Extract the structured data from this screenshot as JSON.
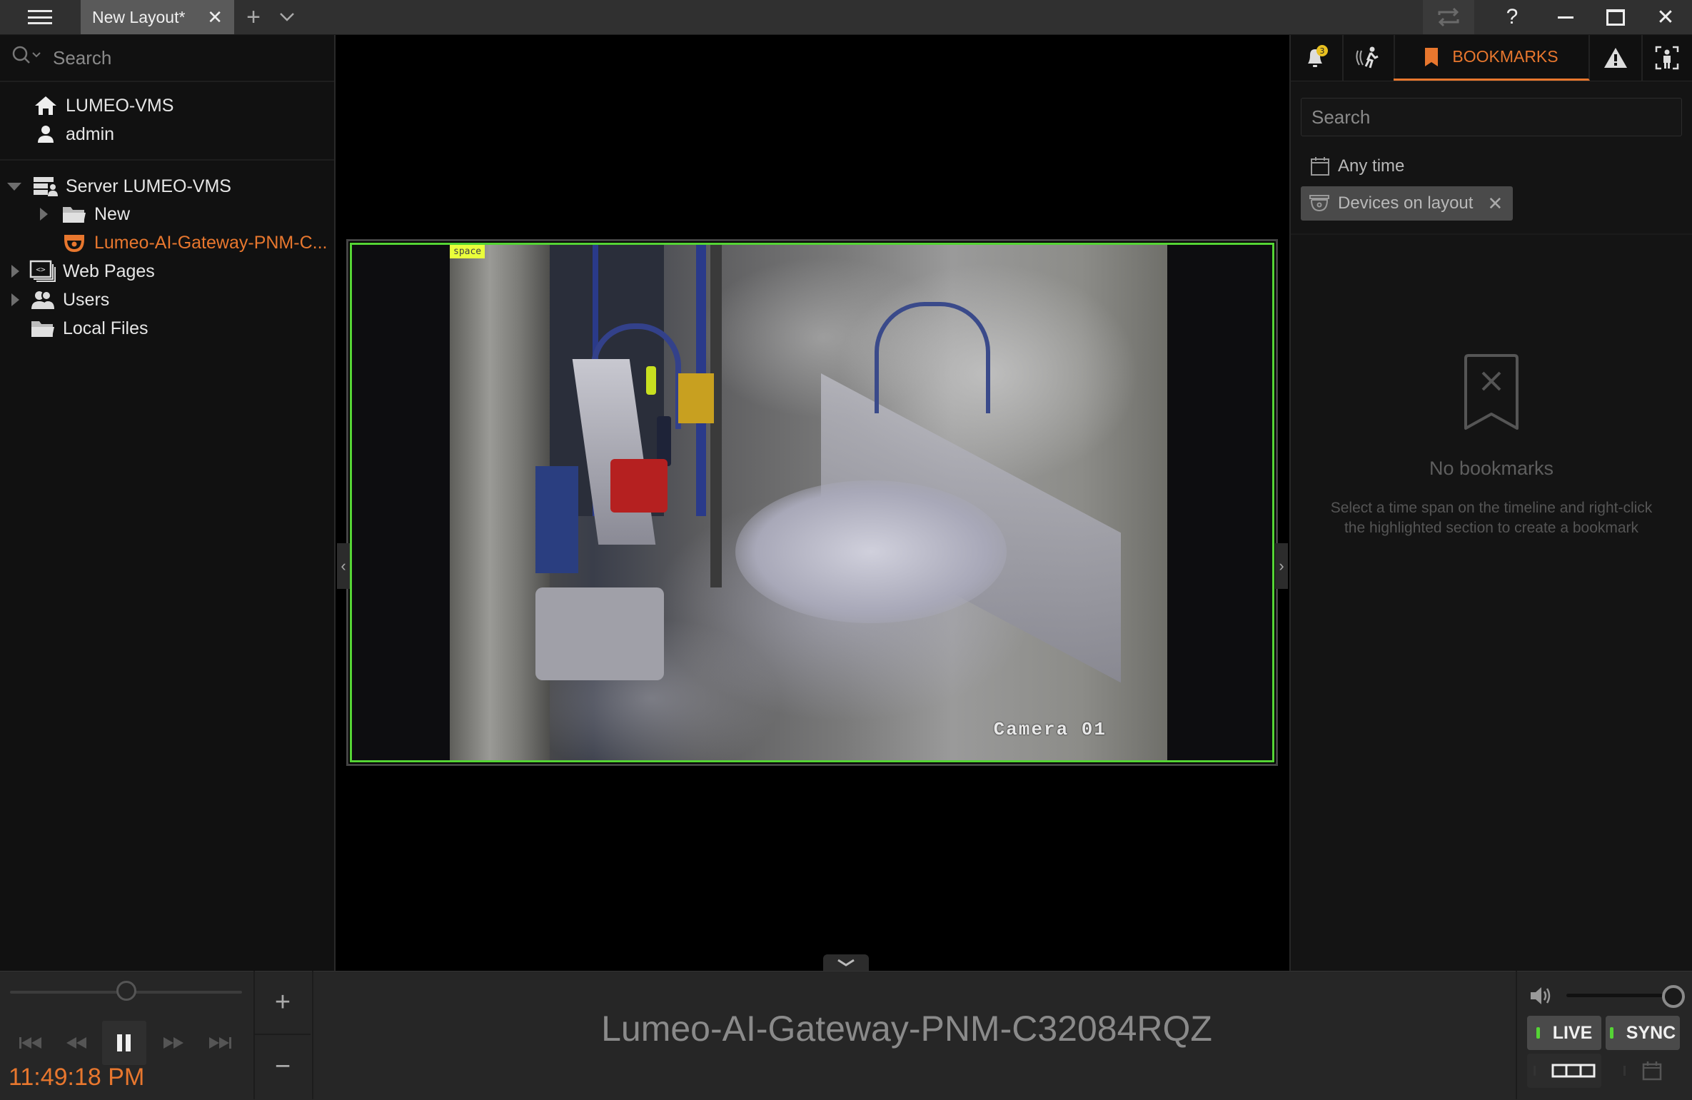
{
  "titlebar": {
    "menu_icon": "hamburger-icon",
    "tab_label": "New Layout*",
    "tab_close": "✕",
    "add_tab": "+",
    "tab_list": "⌄",
    "sync_icon": "sync-icon",
    "help": "?",
    "minimize": "—",
    "maximize": "☐",
    "close": "✕"
  },
  "left_panel": {
    "search_placeholder": "Search",
    "system_name": "LUMEO-VMS",
    "user": "admin",
    "tree": [
      {
        "label": "Server LUMEO-VMS",
        "icon": "server-icon",
        "expanded": true
      },
      {
        "label": "New",
        "icon": "folder-icon",
        "expanded": false
      },
      {
        "label": "Lumeo-AI-Gateway-PNM-C...",
        "icon": "camera-dome-icon",
        "selected": true
      },
      {
        "label": "Web Pages",
        "icon": "web-pages-icon",
        "expanded": false
      },
      {
        "label": "Users",
        "icon": "users-icon",
        "expanded": false
      },
      {
        "label": "Local Files",
        "icon": "folder-icon"
      }
    ]
  },
  "viewport": {
    "tile_label": "space",
    "camera_osd": "Camera 01"
  },
  "right_panel": {
    "tabs": [
      {
        "name": "notifications",
        "icon": "bell-icon",
        "badge": "3"
      },
      {
        "name": "motion",
        "icon": "motion-icon"
      },
      {
        "name": "bookmarks",
        "label": "BOOKMARKS",
        "icon": "bookmark-icon",
        "active": true
      },
      {
        "name": "events",
        "icon": "warning-icon"
      },
      {
        "name": "objects",
        "icon": "person-detect-icon"
      }
    ],
    "search_placeholder": "Search",
    "time_filter": "Any time",
    "device_filter": "Devices on layout",
    "empty_title": "No bookmarks",
    "empty_desc": "Select a time span on the timeline and right-click the highlighted section to create a bookmark"
  },
  "bottom_bar": {
    "speed": 0.5,
    "time": "11:49:18 PM",
    "camera_name": "Lumeo-AI-Gateway-PNM-C32084RQZ",
    "zoom_in": "+",
    "zoom_out": "−",
    "volume": 1.0,
    "live_label": "LIVE",
    "sync_label": "SYNC"
  },
  "colors": {
    "accent": "#e8772e",
    "selection_green": "#55d435",
    "label_yellow": "#eaff3b"
  }
}
